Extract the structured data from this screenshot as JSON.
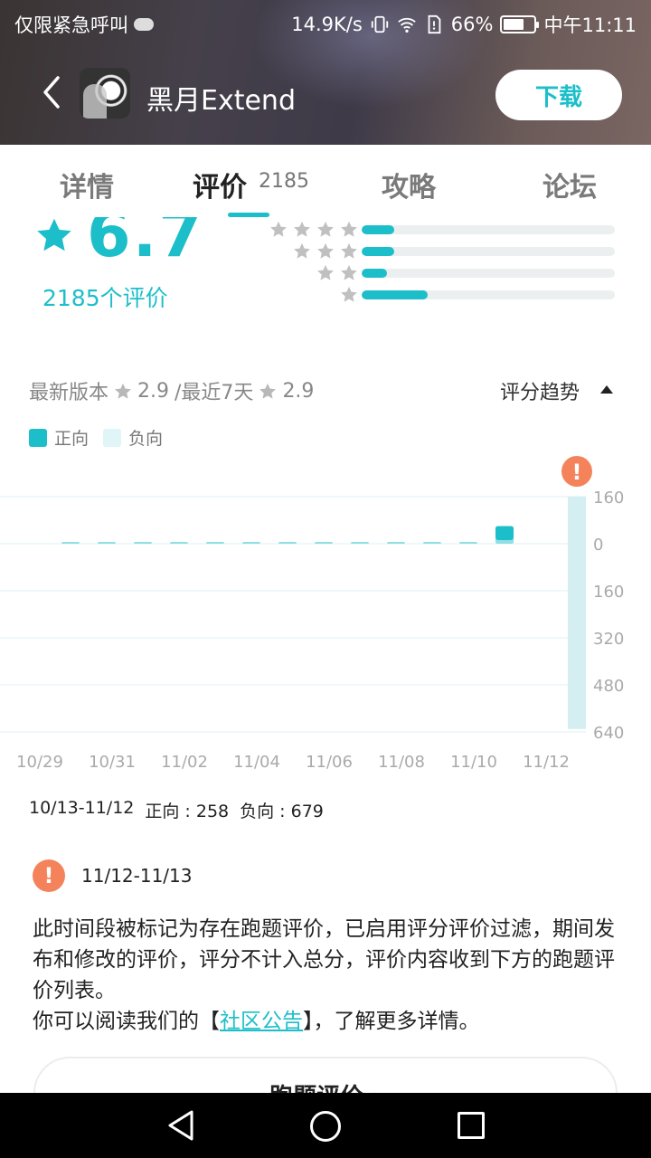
{
  "status_bar": {
    "carrier_text": "仅限紧急呼叫",
    "network_speed": "14.9K/s",
    "battery_percent": "66%",
    "time": "中午11:11",
    "battery_level": 0.66
  },
  "header": {
    "app_name": "黑月Extend",
    "download_label": "下载"
  },
  "tabs": [
    {
      "label": "详情"
    },
    {
      "label": "评价",
      "count": "2185",
      "active": true
    },
    {
      "label": "攻略"
    },
    {
      "label": "论坛"
    }
  ],
  "rating": {
    "score": "6.7",
    "total_label": "2185个评价",
    "distribution": [
      {
        "stars": 5,
        "fraction": 0.13
      },
      {
        "stars": 4,
        "fraction": 0.13
      },
      {
        "stars": 3,
        "fraction": 0.1
      },
      {
        "stars": 2,
        "fraction": 0.0
      },
      {
        "stars": 1,
        "fraction": 0.26
      }
    ]
  },
  "version_info": {
    "latest_label": "最新版本",
    "latest_score": "2.9",
    "recent_label": "/最近7天",
    "recent_score": "2.9",
    "trend_label": "评分趋势"
  },
  "legend": {
    "positive_label": "正向",
    "negative_label": "负向",
    "positive_color": "#1cbfc9",
    "negative_color": "#dff5f7"
  },
  "chart_data": {
    "type": "bar",
    "x": [
      "10/29",
      "10/30",
      "10/31",
      "11/01",
      "11/02",
      "11/03",
      "11/04",
      "11/05",
      "11/06",
      "11/07",
      "11/08",
      "11/09",
      "11/10",
      "11/11",
      "11/12"
    ],
    "x_tick_labels": [
      "10/29",
      "10/31",
      "11/02",
      "11/04",
      "11/06",
      "11/08",
      "11/10",
      "11/12"
    ],
    "y_tick_labels": [
      "160",
      "0",
      "160",
      "320",
      "480",
      "640"
    ],
    "ylim": [
      -640,
      160
    ],
    "series": [
      {
        "name": "正向",
        "values": [
          2,
          2,
          2,
          3,
          3,
          3,
          2,
          3,
          2,
          3,
          3,
          2,
          60,
          0,
          0
        ]
      },
      {
        "name": "负向",
        "values": [
          0,
          0,
          0,
          0,
          0,
          0,
          0,
          0,
          0,
          0,
          0,
          0,
          0,
          0,
          -630
        ]
      }
    ],
    "alert_on": "11/12"
  },
  "period_stats": {
    "range": "10/13-11/12",
    "positive": "正向 : 258",
    "negative": "负向 : 679"
  },
  "notice": {
    "range": "11/12-11/13",
    "text_before": "此时间段被标记为存在跑题评价，已启用评分评价过滤，期间发布和修改的评价，评分不计入总分，评价内容收到下方的跑题评价列表。",
    "text_line2_before": "你可以阅读我们的【",
    "link_text": "社区公告",
    "text_line2_after": "】，了解更多详情。",
    "alert_symbol": "!"
  },
  "offtopic_button_label": "跑题评价 ›"
}
